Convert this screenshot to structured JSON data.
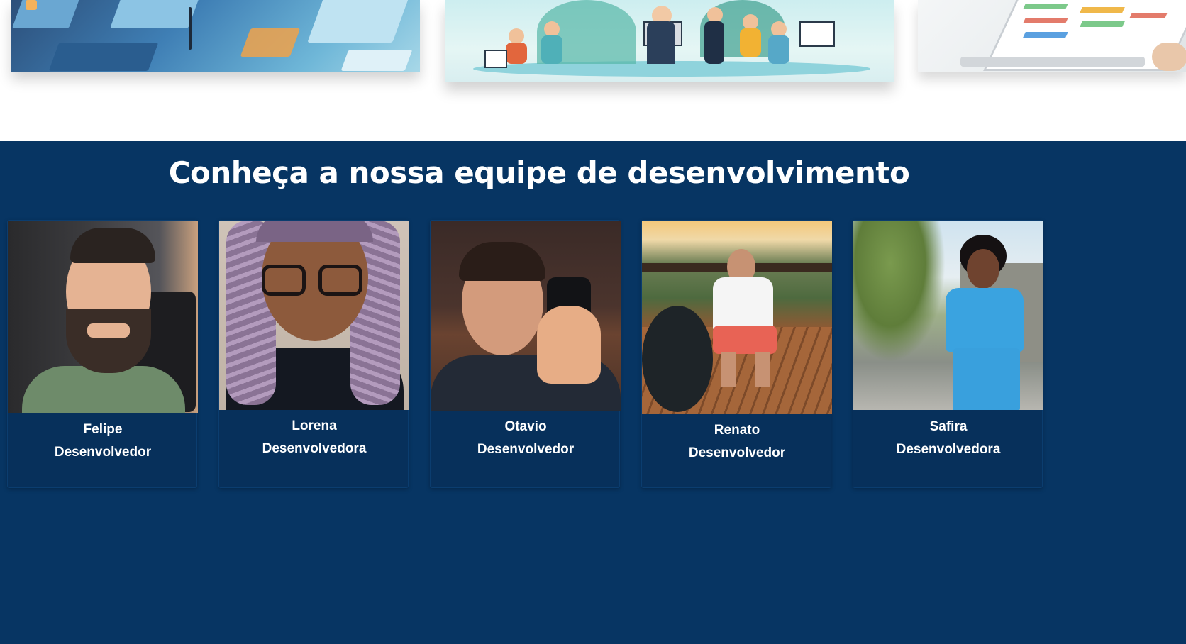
{
  "hero_images": [
    {
      "name": "technology-isometric-image"
    },
    {
      "name": "team-working-illustration"
    },
    {
      "name": "dashboard-laptop-image"
    }
  ],
  "team": {
    "title": "Conheça a nossa equipe de desenvolvimento",
    "members": [
      {
        "name": "Felipe",
        "role": "Desenvolvedor"
      },
      {
        "name": "Lorena",
        "role": "Desenvolvedora"
      },
      {
        "name": "Otavio",
        "role": "Desenvolvedor"
      },
      {
        "name": "Renato",
        "role": "Desenvolvedor"
      },
      {
        "name": "Safira",
        "role": "Desenvolvedora"
      }
    ]
  },
  "colors": {
    "section_background": "#073563",
    "text": "#ffffff"
  }
}
